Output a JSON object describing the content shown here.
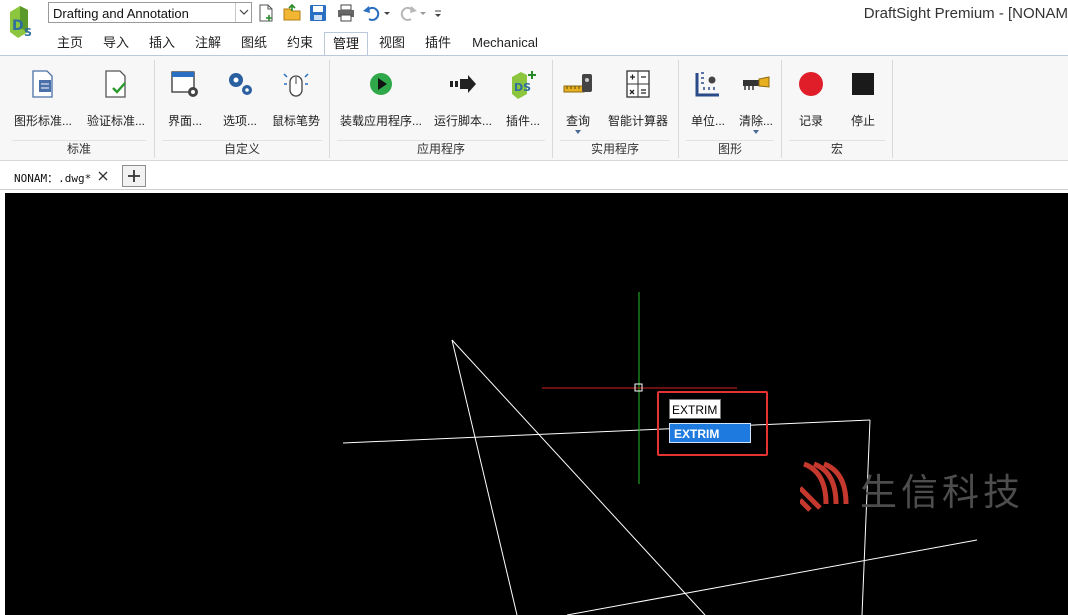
{
  "titlebar": {
    "workspace": "Drafting and Annotation",
    "app_title": "DraftSight Premium - [NONAM"
  },
  "tabs": [
    {
      "label": "主页"
    },
    {
      "label": "导入"
    },
    {
      "label": "插入"
    },
    {
      "label": "注解"
    },
    {
      "label": "图纸"
    },
    {
      "label": "约束"
    },
    {
      "label": "管理",
      "active": true
    },
    {
      "label": "视图"
    },
    {
      "label": "插件"
    },
    {
      "label": "Mechanical"
    }
  ],
  "ribbon": {
    "groups": {
      "standards": {
        "title": "标准",
        "buttons": [
          {
            "label": "图形标准...",
            "icon": "drawing-standards-icon"
          },
          {
            "label": "验证标准...",
            "icon": "check-standards-icon"
          }
        ]
      },
      "customize": {
        "title": "自定义",
        "buttons": [
          {
            "label": "界面...",
            "icon": "interface-settings-icon"
          },
          {
            "label": "选项...",
            "icon": "options-gears-icon"
          },
          {
            "label": "鼠标笔势",
            "icon": "mouse-gesture-icon"
          }
        ]
      },
      "applications": {
        "title": "应用程序",
        "buttons": [
          {
            "label": "装载应用程序...",
            "icon": "load-application-icon"
          },
          {
            "label": "运行脚本...",
            "icon": "run-script-icon"
          },
          {
            "label": "插件...",
            "icon": "add-ins-icon"
          }
        ]
      },
      "utilities": {
        "title": "实用程序",
        "buttons": [
          {
            "label": "查询",
            "icon": "inquiry-measure-icon"
          },
          {
            "label": "智能计算器",
            "icon": "smart-calculator-icon"
          }
        ]
      },
      "drawing": {
        "title": "图形",
        "buttons": [
          {
            "label": "单位...",
            "icon": "units-icon"
          },
          {
            "label": "清除...",
            "icon": "purge-icon"
          }
        ]
      },
      "macro": {
        "title": "宏",
        "buttons": [
          {
            "label": "记录",
            "icon": "record-icon"
          },
          {
            "label": "停止",
            "icon": "stop-icon"
          }
        ]
      }
    }
  },
  "document": {
    "tab_name": "NONAM：.dwg*"
  },
  "command": {
    "typed": "EXTRIM",
    "suggestion": "EXTRIM"
  },
  "watermark": {
    "text": "生信科技"
  },
  "colors": {
    "canvas_bg": "#000000",
    "geometry": "#ffffff",
    "crosshair_x": "#d42020",
    "crosshair_y": "#22c022",
    "highlight_frame": "#e53333",
    "suggestion_bg": "#1f7ae0",
    "record": "#e01e2a",
    "stop": "#1a1a1a"
  }
}
